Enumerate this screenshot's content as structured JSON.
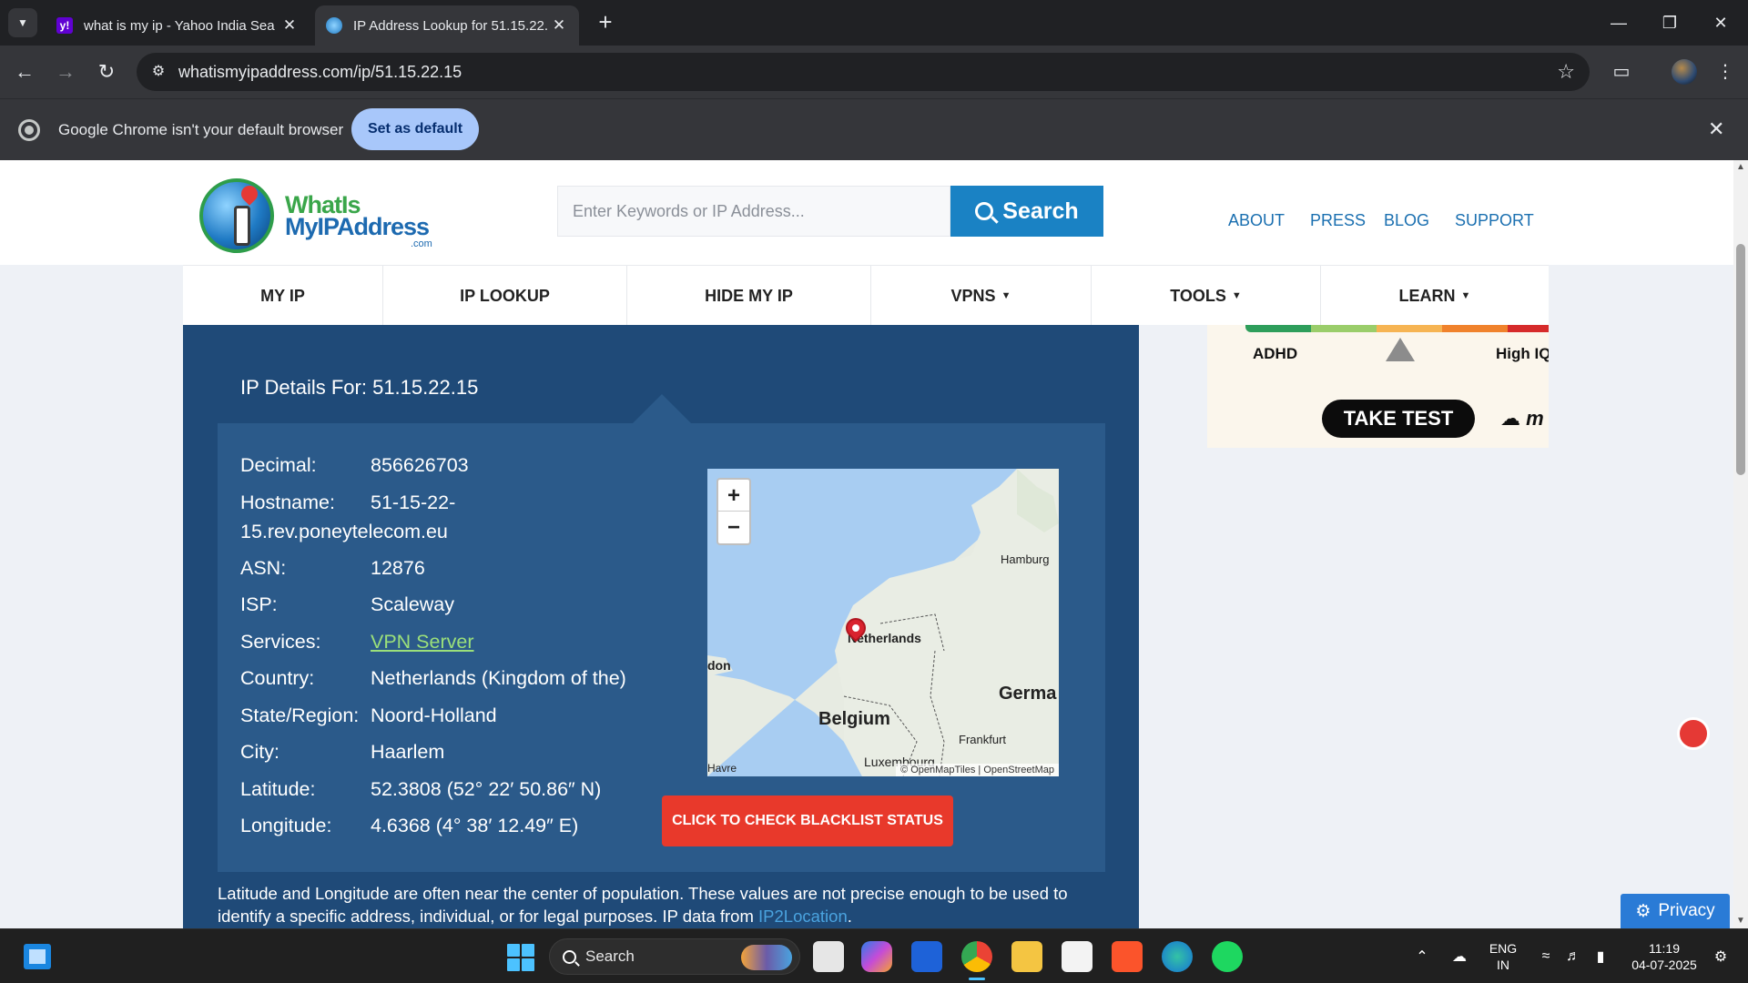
{
  "browser": {
    "tabs": [
      {
        "title": "what is my ip - Yahoo India Sea",
        "favicon": "yahoo-icon",
        "active": false
      },
      {
        "title": "IP Address Lookup for 51.15.22.",
        "favicon": "globe-icon",
        "active": true
      }
    ],
    "url": "whatismyipaddress.com/ip/51.15.22.15",
    "infobar": {
      "message": "Google Chrome isn't your default browser",
      "button": "Set as default"
    }
  },
  "site": {
    "logo": {
      "line1": "WhatIs",
      "line2": "MyIPAddress",
      "line3": ".com"
    },
    "search": {
      "placeholder": "Enter Keywords or IP Address...",
      "button": "Search"
    },
    "toplinks": [
      "ABOUT",
      "PRESS",
      "BLOG",
      "SUPPORT"
    ],
    "nav": [
      "MY IP",
      "IP LOOKUP",
      "HIDE MY IP",
      "VPNS",
      "TOOLS",
      "LEARN"
    ]
  },
  "details": {
    "heading": "IP Details For: 51.15.22.15",
    "decimal_label": "Decimal:",
    "decimal": "856626703",
    "hostname_label": "Hostname:",
    "hostname_part1": "51-15-22-",
    "hostname_part2": "15.rev.poneytelecom.eu",
    "asn_label": "ASN:",
    "asn": "12876",
    "isp_label": "ISP:",
    "isp": "Scaleway",
    "services_label": "Services:",
    "services": "VPN Server",
    "country_label": "Country:",
    "country": "Netherlands (Kingdom of the)",
    "region_label": "State/Region:",
    "region": "Noord-Holland",
    "city_label": "City:",
    "city": "Haarlem",
    "lat_label": "Latitude:",
    "latitude": "52.3808 (52° 22′ 50.86″ N)",
    "lon_label": "Longitude:",
    "longitude": "4.6368 (4° 38′ 12.49″ E)",
    "blacklist_button": "CLICK TO CHECK BLACKLIST STATUS"
  },
  "map": {
    "zoom_in": "+",
    "zoom_out": "−",
    "labels": {
      "hamburg": "Hamburg",
      "netherlands": "Netherlands",
      "london": "don",
      "germany": "Germa",
      "belgium": "Belgium",
      "frankfurt": "Frankfurt",
      "luxembourg": "Luxembourg",
      "havre": "Havre"
    },
    "attribution": "© OpenMapTiles | OpenStreetMap"
  },
  "disclaimer": {
    "text": "Latitude and Longitude are often near the center of population. These values are not precise enough to be used to identify a specific address, individual, or for legal purposes. IP data from ",
    "source": "IP2Location",
    "end": "."
  },
  "ad": {
    "left_label": "ADHD",
    "right_label": "High IQ",
    "button": "TAKE TEST",
    "brand": "m"
  },
  "privacy": {
    "label": "Privacy"
  },
  "taskbar": {
    "search": "Search",
    "lang": "ENG",
    "region": "IN",
    "time": "11:19",
    "date": "04-07-2025"
  }
}
